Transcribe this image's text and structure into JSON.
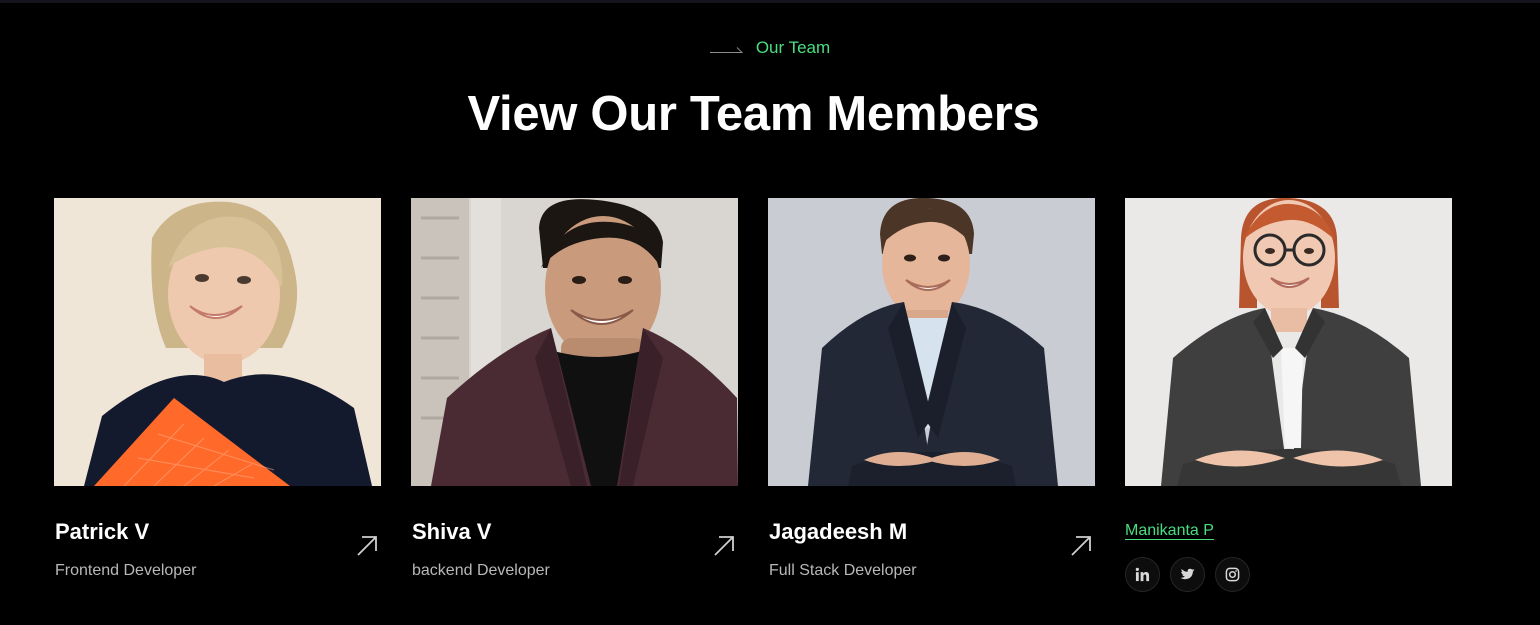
{
  "section": {
    "label": "Our Team",
    "title": "View Our Team Members"
  },
  "members": [
    {
      "name": "Patrick V",
      "role": "Frontend Developer"
    },
    {
      "name": "Shiva V",
      "role": "backend Developer"
    },
    {
      "name": "Jagadeesh M",
      "role": "Full Stack Developer"
    },
    {
      "name": "Manikanta P"
    }
  ],
  "socials": [
    {
      "icon": "linkedin-icon"
    },
    {
      "icon": "twitter-icon"
    },
    {
      "icon": "instagram-icon"
    }
  ],
  "colors": {
    "accent": "#4ade80",
    "background": "#000000",
    "text": "#ffffff",
    "muted": "#b8b8b8"
  }
}
